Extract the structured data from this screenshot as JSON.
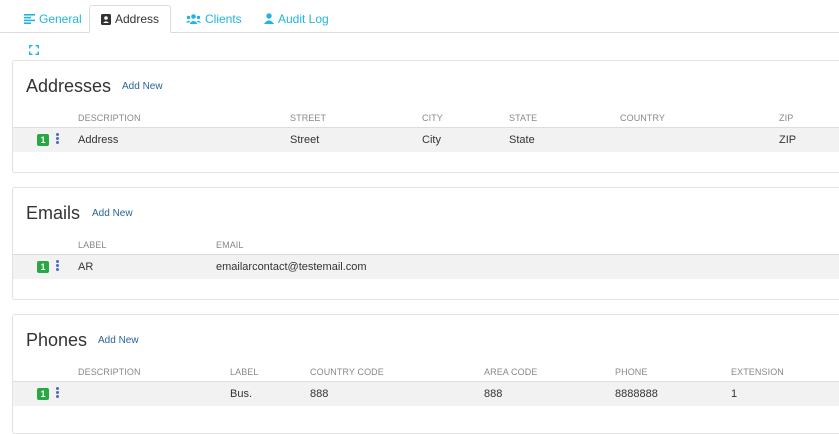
{
  "tabs": [
    {
      "label": "General",
      "icon": "list-icon",
      "active": false
    },
    {
      "label": "Address",
      "icon": "address-card-icon",
      "active": true
    },
    {
      "label": "Clients",
      "icon": "users-icon",
      "active": false
    },
    {
      "label": "Audit Log",
      "icon": "user-icon",
      "active": false
    }
  ],
  "colors": {
    "accent": "#20b5e0",
    "link": "#2a6496",
    "badge": "#28a745",
    "row_bg": "#f2f2f2"
  },
  "addresses": {
    "title": "Addresses",
    "add_new": "Add New",
    "columns": [
      "DESCRIPTION",
      "STREET",
      "CITY",
      "STATE",
      "COUNTRY",
      "ZIP"
    ],
    "rows": [
      {
        "index": "1",
        "description": "Address",
        "street": "Street",
        "city": "City",
        "state": "State",
        "country": "",
        "zip": "ZIP"
      }
    ]
  },
  "emails": {
    "title": "Emails",
    "add_new": "Add New",
    "columns": [
      "LABEL",
      "EMAIL"
    ],
    "rows": [
      {
        "index": "1",
        "label": "AR",
        "email": "emailarcontact@testemail.com"
      }
    ]
  },
  "phones": {
    "title": "Phones",
    "add_new": "Add New",
    "columns": [
      "DESCRIPTION",
      "LABEL",
      "COUNTRY CODE",
      "AREA CODE",
      "PHONE",
      "EXTENSION"
    ],
    "rows": [
      {
        "index": "1",
        "description": "",
        "label": "Bus.",
        "country_code": "888",
        "area_code": "888",
        "phone": "8888888",
        "extension": "1"
      }
    ]
  }
}
